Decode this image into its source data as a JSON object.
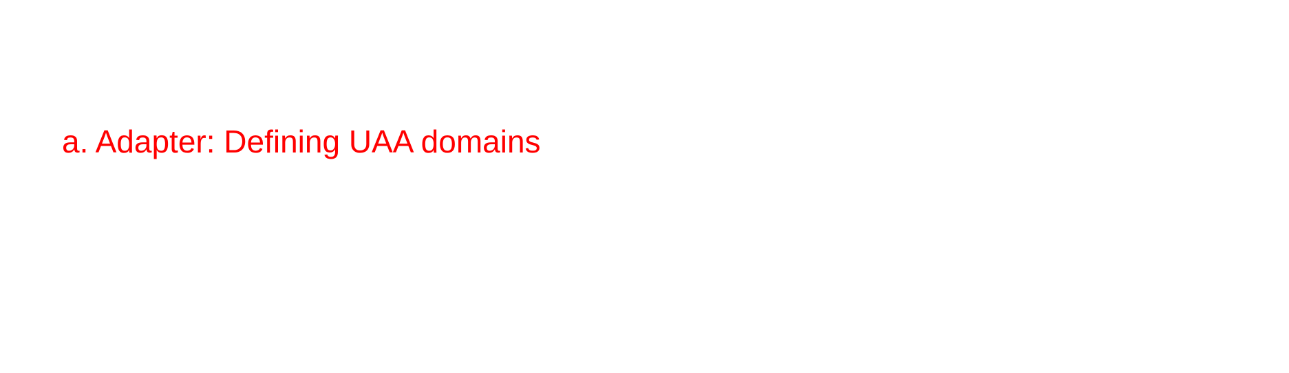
{
  "heading": {
    "text": "a. Adapter: Defining UAA domains",
    "color": "#ff0000"
  }
}
